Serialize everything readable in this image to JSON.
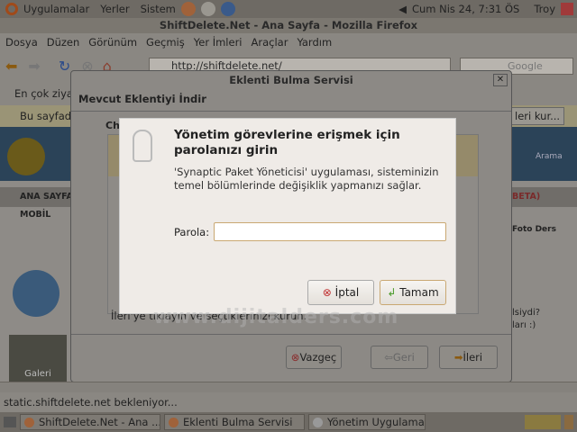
{
  "top_panel": {
    "menus": [
      "Uygulamalar",
      "Yerler",
      "Sistem"
    ],
    "clock": "Cum Nis 24,  7:31 ÖS",
    "user": "Troy"
  },
  "firefox": {
    "title": "ShiftDelete.Net - Ana Sayfa - Mozilla Firefox",
    "menu": [
      "Dosya",
      "Düzen",
      "Görünüm",
      "Geçmiş",
      "Yer İmleri",
      "Araçlar",
      "Yardım"
    ],
    "url": "http://shiftdelete.net/",
    "search_placeholder": "Google",
    "bookmarks": "En çok ziya",
    "infobar": "Bu sayfada",
    "infobar_button": "leri kur...",
    "status": "static.shiftdelete.net bekleniyor..."
  },
  "site": {
    "nav": [
      "ANA SAYFA",
      "MOBİL"
    ],
    "beta": "BETA)",
    "search": "Arama",
    "foto": "Foto Ders",
    "side1": "lsiydi?",
    "side2": "ları :)",
    "gallery": "Galeri"
  },
  "plugin_dialog": {
    "title": "Eklenti Bulma Servisi",
    "subtitle": "Mevcut Eklentiyi İndir",
    "partial": "Ch",
    "footer_text": "İleri'ye tıklayın ve seçtiklerinizi kurun.",
    "cancel": "Vazgeç",
    "back": "Geri",
    "next": "İleri"
  },
  "auth_dialog": {
    "heading": "Yönetim görevlerine erişmek için parolanızı girin",
    "message": "'Synaptic Paket Yöneticisi' uygulaması, sisteminizin temel bölümlerinde değişiklik yapmanızı sağlar.",
    "password_label": "Parola:",
    "password_value": "",
    "cancel": "İptal",
    "ok": "Tamam"
  },
  "watermark": "www.dijitalders.com",
  "taskbar": [
    "ShiftDelete.Net - Ana ...",
    "Eklenti Bulma Servisi",
    "Yönetim Uygulaması B..."
  ]
}
